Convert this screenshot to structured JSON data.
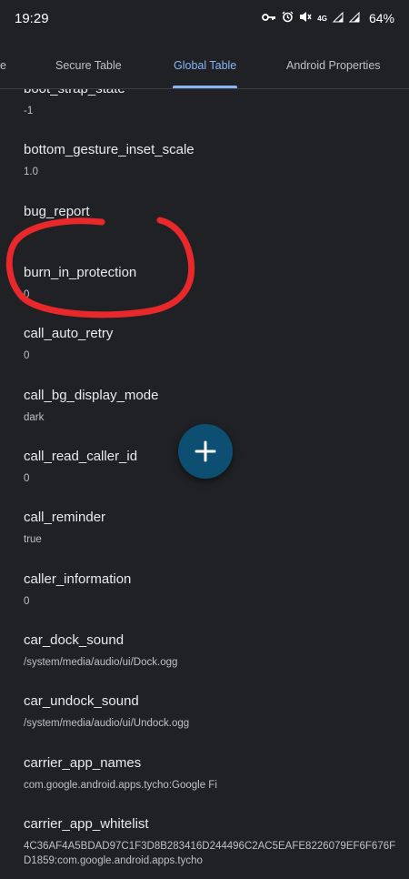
{
  "status_bar": {
    "time": "19:29",
    "network": "4G",
    "battery": "64%"
  },
  "tabs": [
    {
      "label": "e"
    },
    {
      "label": "Secure Table"
    },
    {
      "label": "Global Table"
    },
    {
      "label": "Android Properties"
    }
  ],
  "settings": [
    {
      "key": "boot_strap_state",
      "value": "-1"
    },
    {
      "key": "bottom_gesture_inset_scale",
      "value": "1.0"
    },
    {
      "key": "bug_report",
      "value": ""
    },
    {
      "key": "burn_in_protection",
      "value": "0"
    },
    {
      "key": "call_auto_retry",
      "value": "0"
    },
    {
      "key": "call_bg_display_mode",
      "value": "dark"
    },
    {
      "key": "call_read_caller_id",
      "value": "0"
    },
    {
      "key": "call_reminder",
      "value": "true"
    },
    {
      "key": "caller_information",
      "value": "0"
    },
    {
      "key": "car_dock_sound",
      "value": "/system/media/audio/ui/Dock.ogg"
    },
    {
      "key": "car_undock_sound",
      "value": "/system/media/audio/ui/Undock.ogg"
    },
    {
      "key": "carrier_app_names",
      "value": "com.google.android.apps.tycho:Google Fi"
    },
    {
      "key": "carrier_app_whitelist",
      "value": "4C36AF4A5BDAD97C1F3D8B283416D244496C2AC5EAFE8226079EF6F676FD1859:com.google.android.apps.tycho"
    }
  ],
  "annotation_color": "#e8282b",
  "fab_icon": "plus-icon",
  "icons": [
    "vpn-key-icon",
    "alarm-icon",
    "mute-icon",
    "signal-icon",
    "signal-icon"
  ]
}
